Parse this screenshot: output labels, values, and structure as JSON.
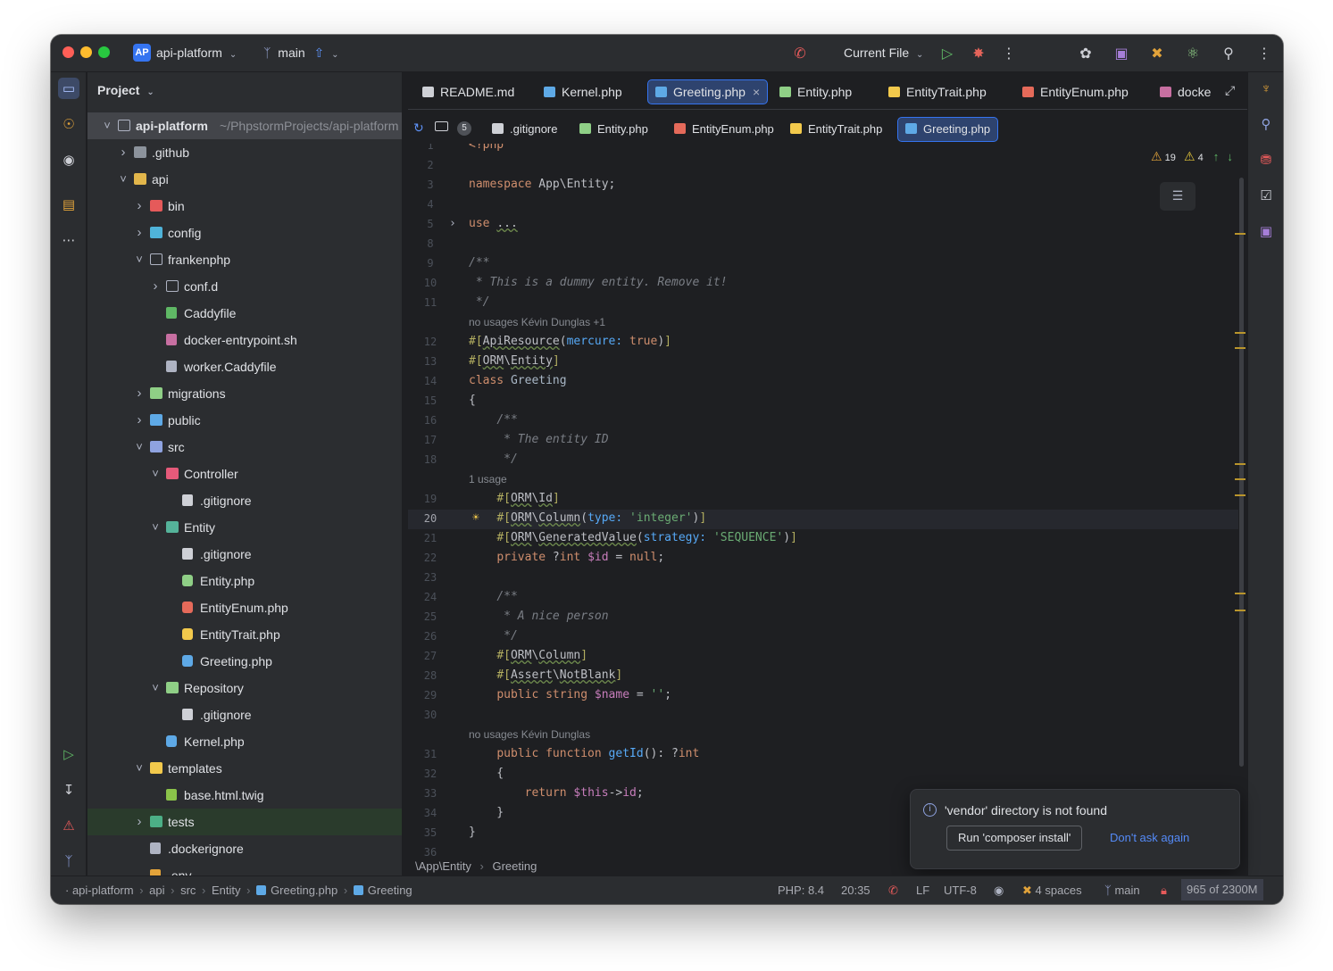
{
  "titlebar": {
    "project_badge": "AP",
    "project_name": "api-platform",
    "branch": "main",
    "run_config": "Current File"
  },
  "project_panel": {
    "title": "Project",
    "root": {
      "name": "api-platform",
      "path": "~/PhpstormProjects/api-platform"
    },
    "tree": [
      {
        "label": "api-platform",
        "depth": 0,
        "expanded": true,
        "kind": "folder"
      },
      {
        "label": ".github",
        "depth": 1,
        "expanded": false,
        "kind": "folder"
      },
      {
        "label": "api",
        "depth": 1,
        "expanded": true,
        "kind": "folder"
      },
      {
        "label": "bin",
        "depth": 2,
        "expanded": false,
        "kind": "folder"
      },
      {
        "label": "config",
        "depth": 2,
        "expanded": false,
        "kind": "folder"
      },
      {
        "label": "frankenphp",
        "depth": 2,
        "expanded": true,
        "kind": "folder"
      },
      {
        "label": "conf.d",
        "depth": 3,
        "expanded": false,
        "kind": "folder"
      },
      {
        "label": "Caddyfile",
        "depth": 3,
        "kind": "file"
      },
      {
        "label": "docker-entrypoint.sh",
        "depth": 3,
        "kind": "file"
      },
      {
        "label": "worker.Caddyfile",
        "depth": 3,
        "kind": "file"
      },
      {
        "label": "migrations",
        "depth": 2,
        "expanded": false,
        "kind": "folder"
      },
      {
        "label": "public",
        "depth": 2,
        "expanded": false,
        "kind": "folder"
      },
      {
        "label": "src",
        "depth": 2,
        "expanded": true,
        "kind": "folder"
      },
      {
        "label": "Controller",
        "depth": 3,
        "expanded": true,
        "kind": "folder"
      },
      {
        "label": ".gitignore",
        "depth": 4,
        "kind": "file"
      },
      {
        "label": "Entity",
        "depth": 3,
        "expanded": true,
        "kind": "folder"
      },
      {
        "label": ".gitignore",
        "depth": 4,
        "kind": "file"
      },
      {
        "label": "Entity.php",
        "depth": 4,
        "kind": "file"
      },
      {
        "label": "EntityEnum.php",
        "depth": 4,
        "kind": "file"
      },
      {
        "label": "EntityTrait.php",
        "depth": 4,
        "kind": "file"
      },
      {
        "label": "Greeting.php",
        "depth": 4,
        "kind": "file"
      },
      {
        "label": "Repository",
        "depth": 3,
        "expanded": true,
        "kind": "folder"
      },
      {
        "label": ".gitignore",
        "depth": 4,
        "kind": "file"
      },
      {
        "label": "Kernel.php",
        "depth": 3,
        "kind": "file"
      },
      {
        "label": "templates",
        "depth": 2,
        "expanded": true,
        "kind": "folder"
      },
      {
        "label": "base.html.twig",
        "depth": 3,
        "kind": "file"
      },
      {
        "label": "tests",
        "depth": 2,
        "expanded": false,
        "kind": "folder"
      },
      {
        "label": ".dockerignore",
        "depth": 2,
        "kind": "file"
      },
      {
        "label": ".env",
        "depth": 2,
        "kind": "file"
      }
    ]
  },
  "editor_tabs": [
    {
      "label": "README.md",
      "active": false
    },
    {
      "label": "Kernel.php",
      "active": false
    },
    {
      "label": "Greeting.php",
      "active": true,
      "close": "×"
    },
    {
      "label": "Entity.php",
      "active": false
    },
    {
      "label": "EntityTrait.php",
      "active": false
    },
    {
      "label": "EntityEnum.php",
      "active": false
    },
    {
      "label": "docke",
      "active": false
    }
  ],
  "secondary_tabs": {
    "count_badge": "5",
    "items": [
      {
        "label": ".gitignore",
        "active": false
      },
      {
        "label": "Entity.php",
        "active": false
      },
      {
        "label": "EntityEnum.php",
        "active": false
      },
      {
        "label": "EntityTrait.php",
        "active": false
      },
      {
        "label": "Greeting.php",
        "active": true
      }
    ]
  },
  "inspections": {
    "warnings": "19",
    "weak_warnings": "4"
  },
  "code": {
    "current_line": "20",
    "lines": [
      {
        "n": "1",
        "html": "<span class=\"kw\">&lt;?php</span>"
      },
      {
        "n": "2",
        "html": ""
      },
      {
        "n": "3",
        "html": "<span class=\"kw\">namespace</span> App\\Entity;"
      },
      {
        "n": "4",
        "html": ""
      },
      {
        "n": "5",
        "html": "<span class=\"kw\">use</span> <span class=\"an\">...</span>"
      },
      {
        "n": "8",
        "html": ""
      },
      {
        "n": "9",
        "html": "<span class=\"cm\">/**</span>"
      },
      {
        "n": "10",
        "html": "<span class=\"cm\"> * This is a dummy entity. Remove it!</span>"
      },
      {
        "n": "11",
        "html": "<span class=\"cm\"> */</span>"
      },
      {
        "inlay": "no usages   Kévin Dunglas +1"
      },
      {
        "n": "12",
        "html": "<span class=\"at\">#[</span><span class=\"an\">ApiResource</span>(<span class=\"pn\">mercure:</span> <span class=\"kw\">true</span>)<span class=\"at\">]</span>"
      },
      {
        "n": "13",
        "html": "<span class=\"at\">#[</span><span class=\"an\">ORM</span>\\<span class=\"an\">Entity</span><span class=\"at\">]</span>"
      },
      {
        "n": "14",
        "html": "<span class=\"kw\">class</span> <span class=\"gy\">Greeting</span>"
      },
      {
        "n": "15",
        "html": "{"
      },
      {
        "n": "16",
        "html": "    <span class=\"cm\">/**</span>"
      },
      {
        "n": "17",
        "html": "<span class=\"cm\">     * The entity ID</span>"
      },
      {
        "n": "18",
        "html": "<span class=\"cm\">     */</span>"
      },
      {
        "inlay": "    1 usage"
      },
      {
        "n": "19",
        "html": "    <span class=\"at\">#[</span><span class=\"an\">ORM</span>\\<span class=\"an\">Id</span><span class=\"at\">]</span>"
      },
      {
        "n": "20",
        "html": "    <span class=\"at\">#[</span><span class=\"an\">ORM</span>\\<span class=\"an\">Column</span>(<span class=\"pn\">type:</span> <span class=\"str\">'integer'</span>)<span class=\"at\">]</span>"
      },
      {
        "n": "21",
        "html": "    <span class=\"at\">#[</span><span class=\"an\">ORM</span>\\<span class=\"an\">GeneratedValue</span>(<span class=\"pn\">strategy:</span> <span class=\"str\">'SEQUENCE'</span>)<span class=\"at\">]</span>"
      },
      {
        "n": "22",
        "html": "    <span class=\"kw\">private</span> ?<span class=\"kw\">int</span> <span class=\"var\">$id</span> = <span class=\"kw\">null</span>;"
      },
      {
        "n": "23",
        "html": ""
      },
      {
        "n": "24",
        "html": "    <span class=\"cm\">/**</span>"
      },
      {
        "n": "25",
        "html": "<span class=\"cm\">     * A nice person</span>"
      },
      {
        "n": "26",
        "html": "<span class=\"cm\">     */</span>"
      },
      {
        "n": "27",
        "html": "    <span class=\"at\">#[</span><span class=\"an\">ORM</span>\\<span class=\"an\">Column</span><span class=\"at\">]</span>"
      },
      {
        "n": "28",
        "html": "    <span class=\"at\">#[</span><span class=\"an\">Assert</span>\\<span class=\"an\">NotBlank</span><span class=\"at\">]</span>"
      },
      {
        "n": "29",
        "html": "    <span class=\"kw\">public</span> <span class=\"kw\">string</span> <span class=\"var\">$name</span> = <span class=\"str\">''</span>;"
      },
      {
        "n": "30",
        "html": ""
      },
      {
        "inlay": "    no usages   Kévin Dunglas"
      },
      {
        "n": "31",
        "html": "    <span class=\"kw\">public function</span> <span class=\"fn\">getId</span>(): ?<span class=\"kw\">int</span>"
      },
      {
        "n": "32",
        "html": "    {"
      },
      {
        "n": "33",
        "html": "        <span class=\"kw\">return</span> <span class=\"var\">$this</span>-&gt;<span class=\"var\">id</span>;"
      },
      {
        "n": "34",
        "html": "    }"
      },
      {
        "n": "35",
        "html": "}"
      },
      {
        "n": "36",
        "html": ""
      }
    ]
  },
  "editor_breadcrumb": {
    "namespace": "\\App\\Entity",
    "class": "Greeting"
  },
  "notification": {
    "message": "'vendor' directory is not found",
    "action": "Run 'composer install'",
    "dismiss": "Don't ask again"
  },
  "statusbar": {
    "path": [
      "api-platform",
      "api",
      "src",
      "Entity",
      "Greeting.php",
      "Greeting"
    ],
    "php": "PHP: 8.4",
    "position": "20:35",
    "line_sep": "LF",
    "encoding": "UTF-8",
    "indent": "4 spaces",
    "branch": "main",
    "memory": "965 of 2300M"
  }
}
